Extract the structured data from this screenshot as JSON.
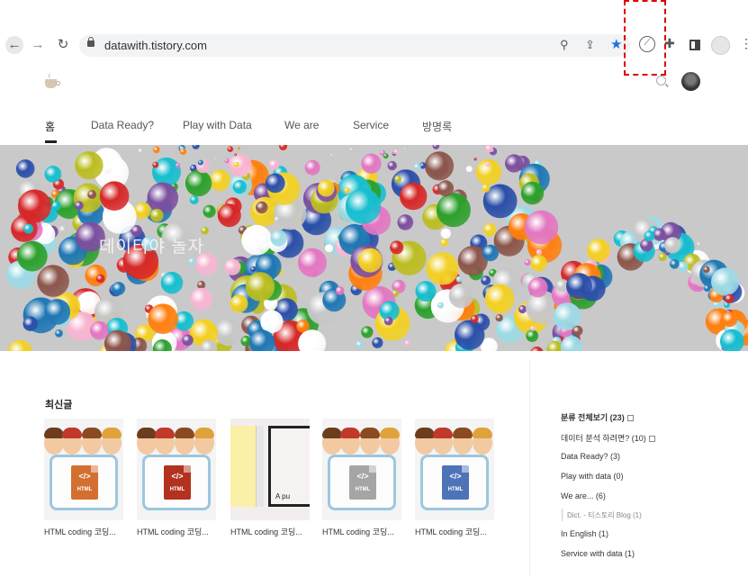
{
  "browser": {
    "url": "datawith.tistory.com",
    "icons": [
      "back-arrow-icon",
      "forward-arrow-icon",
      "reload-icon",
      "lock-icon",
      "zoom-icon",
      "share-icon",
      "bookmark-star-icon",
      "compass-extension-icon",
      "puzzle-icon",
      "side-panel-icon",
      "profile-icon",
      "kebab-menu-icon"
    ],
    "colors": {
      "star": "#1a73e8",
      "highlight": "#dd0000"
    }
  },
  "blog": {
    "menu": [
      {
        "label": "홈",
        "active": true
      },
      {
        "label": "Data Ready?"
      },
      {
        "label": "Play with Data"
      },
      {
        "label": "We are"
      },
      {
        "label": "Service"
      },
      {
        "label": "방명록"
      }
    ],
    "hero_title": "데이터야 놀자",
    "recent_title": "최신글",
    "posts": [
      {
        "title": "HTML coding 코딩...",
        "file_color": "#d46f32"
      },
      {
        "title": "HTML coding 코딩...",
        "file_color": "#b3321f"
      },
      {
        "title": "HTML coding 코딩...",
        "thumb_text": "A pu"
      },
      {
        "title": "HTML coding 코딩...",
        "file_color": "#a5a5a5"
      },
      {
        "title": "HTML coding 코딩...",
        "file_color": "#4e73b8"
      }
    ],
    "html_file_code": "</>",
    "html_file_label": "HTML",
    "categories": {
      "all": "분류 전체보기 (23)",
      "items": [
        "데이터 분석 하려면? (10)",
        "Data Ready? (3)",
        "Play with data (0)",
        "We are... (6)"
      ],
      "sub": "Dict. - 티스토리 Blog (1)",
      "more": [
        "In English (1)",
        "Service with data (1)"
      ]
    }
  }
}
